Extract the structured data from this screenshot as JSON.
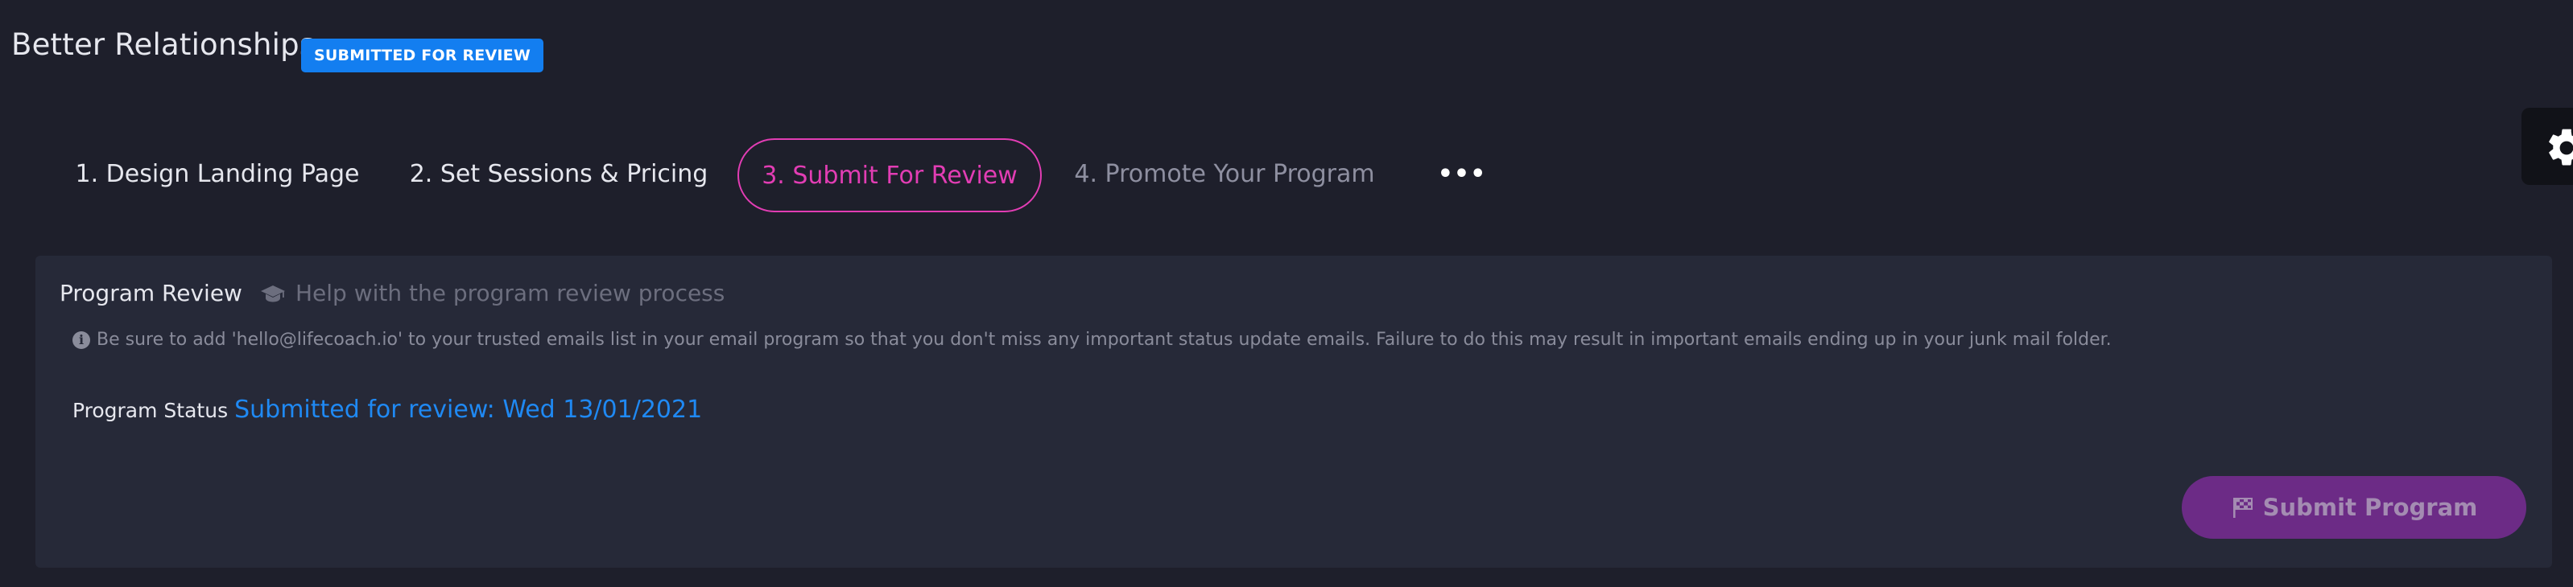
{
  "header": {
    "title": "Better Relationships",
    "badge": "SUBMITTED FOR REVIEW",
    "badge_color": "#137ef0"
  },
  "tabs": [
    {
      "label": "1. Design Landing Page",
      "state": "default"
    },
    {
      "label": "2. Set Sessions & Pricing",
      "state": "default"
    },
    {
      "label": "3. Submit For Review",
      "state": "active"
    },
    {
      "label": "4. Promote Your Program",
      "state": "disabled"
    },
    {
      "label": "•••",
      "state": "default"
    }
  ],
  "panel": {
    "title": "Program Review",
    "help_text": "Help with the program review process",
    "help_icon": "graduation-cap-icon",
    "notice": "Be sure to add 'hello@lifecoach.io' to your trusted emails list in your email program so that you don't miss any important status update emails. Failure to do this may result in important emails ending up in your junk mail folder.",
    "status_label": "Program Status",
    "status_value": "Submitted for review: Wed 13/01/2021",
    "submit_label": "Submit Program",
    "submit_icon": "flag-checkered-icon"
  },
  "colors": {
    "background": "#1e1f2b",
    "panel": "#262938",
    "accent_pink": "#e23db4",
    "status_blue": "#1f89f3",
    "submit_button": "#6c2b86"
  },
  "side_icon": "gear-icon"
}
